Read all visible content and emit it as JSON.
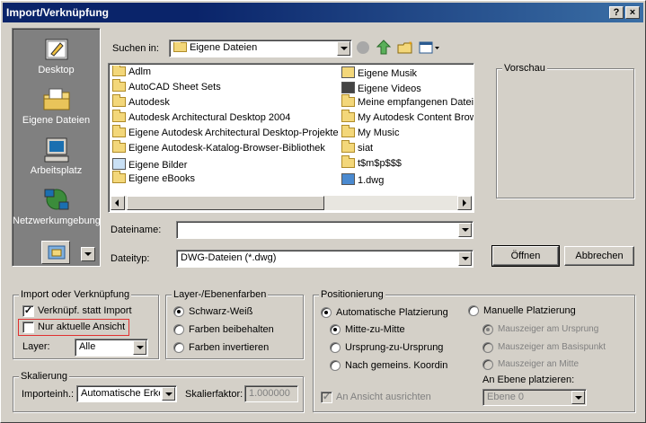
{
  "window": {
    "title": "Import/Verknüpfung",
    "help_label": "?",
    "close_label": "×"
  },
  "places": [
    {
      "label": "Desktop"
    },
    {
      "label": "Eigene Dateien"
    },
    {
      "label": "Arbeitsplatz"
    },
    {
      "label": "Netzwerkumgebung"
    }
  ],
  "lookin": {
    "label": "Suchen in:",
    "value": "Eigene Dateien"
  },
  "files_left": [
    "Adlm",
    "AutoCAD Sheet Sets",
    "Autodesk",
    "Autodesk Architectural Desktop 2004",
    "Eigene Autodesk Architectural Desktop-Projekte",
    "Eigene Autodesk-Katalog-Browser-Bibliothek",
    "Eigene Bilder",
    "Eigene eBooks"
  ],
  "files_right": [
    "Eigene Musik",
    "Eigene Videos",
    "Meine empfangenen Dateien",
    "My Autodesk Content Browser",
    "My Music",
    "siat",
    "t$m$p$$$",
    "1.dwg"
  ],
  "preview": {
    "label": "Vorschau"
  },
  "filename": {
    "label": "Dateiname:",
    "value": ""
  },
  "filetype": {
    "label": "Dateityp:",
    "value": "DWG-Dateien (*.dwg)"
  },
  "buttons": {
    "open": "Öffnen",
    "cancel": "Abbrechen"
  },
  "import_group": {
    "caption": "Import oder Verknüpfung",
    "link_instead": "Verknüpf. statt Import",
    "current_view": "Nur aktuelle Ansicht",
    "layer_label": "Layer:",
    "layer_value": "Alle"
  },
  "layer_colors": {
    "caption": "Layer-/Ebenenfarben",
    "options": [
      "Schwarz-Weiß",
      "Farben beibehalten",
      "Farben invertieren"
    ]
  },
  "positioning": {
    "caption": "Positionierung",
    "auto": "Automatische Platzierung",
    "manual": "Manuelle Platzierung",
    "auto_options": [
      "Mitte-zu-Mitte",
      "Ursprung-zu-Ursprung",
      "Nach gemeins. Koordin"
    ],
    "manual_options": [
      "Mauszeiger am Ursprung",
      "Mauszeiger am Basispunkt",
      "Mauszeiger an Mitte"
    ],
    "align_view": "An Ansicht ausrichten",
    "level_label": "An Ebene platzieren:",
    "level_value": "Ebene 0"
  },
  "scaling": {
    "caption": "Skalierung",
    "unit_label": "Importeinh.:",
    "unit_value": "Automatische Erkennung",
    "factor_label": "Skalierfaktor:",
    "factor_value": "1.000000"
  },
  "colors": {
    "title_bg": "#0a246a",
    "face": "#d4d0c8",
    "highlight_box": "#e03030"
  }
}
